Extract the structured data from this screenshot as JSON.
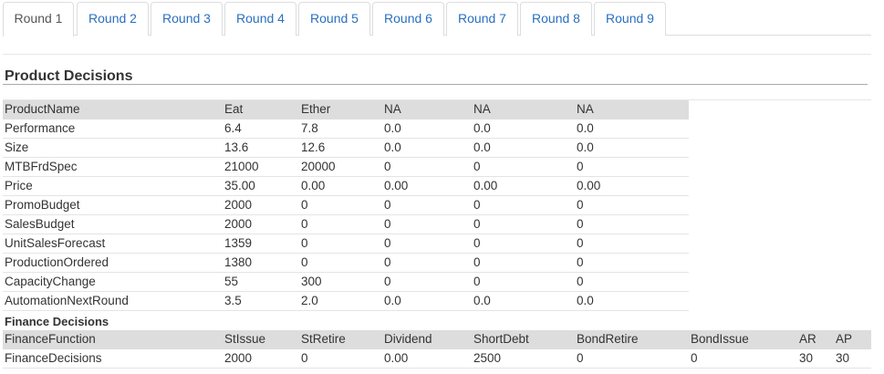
{
  "tabs": [
    "Round 1",
    "Round 2",
    "Round 3",
    "Round 4",
    "Round 5",
    "Round 6",
    "Round 7",
    "Round 8",
    "Round 9"
  ],
  "active_tab": 0,
  "product_section": {
    "title": "Product Decisions",
    "columns": [
      "ProductName",
      "Eat",
      "Ether",
      "NA",
      "NA",
      "NA"
    ],
    "rows": [
      [
        "Performance",
        "6.4",
        "7.8",
        "0.0",
        "0.0",
        "0.0"
      ],
      [
        "Size",
        "13.6",
        "12.6",
        "0.0",
        "0.0",
        "0.0"
      ],
      [
        "MTBFrdSpec",
        "21000",
        "20000",
        "0",
        "0",
        "0"
      ],
      [
        "Price",
        "35.00",
        "0.00",
        "0.00",
        "0.00",
        "0.00"
      ],
      [
        "PromoBudget",
        "2000",
        "0",
        "0",
        "0",
        "0"
      ],
      [
        "SalesBudget",
        "2000",
        "0",
        "0",
        "0",
        "0"
      ],
      [
        "UnitSalesForecast",
        "1359",
        "0",
        "0",
        "0",
        "0"
      ],
      [
        "ProductionOrdered",
        "1380",
        "0",
        "0",
        "0",
        "0"
      ],
      [
        "CapacityChange",
        "55",
        "300",
        "0",
        "0",
        "0"
      ],
      [
        "AutomationNextRound",
        "3.5",
        "2.0",
        "0.0",
        "0.0",
        "0.0"
      ]
    ]
  },
  "finance_section": {
    "title": "Finance Decisions",
    "columns": [
      "FinanceFunction",
      "StIssue",
      "StRetire",
      "Dividend",
      "ShortDebt",
      "BondRetire",
      "BondIssue",
      "AR",
      "AP"
    ],
    "rows": [
      [
        "FinanceDecisions",
        "2000",
        "0",
        "0.00",
        "2500",
        "0",
        "0",
        "30",
        "30"
      ]
    ]
  }
}
